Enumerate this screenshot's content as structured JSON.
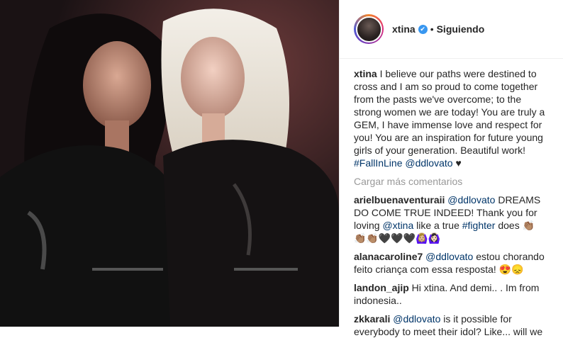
{
  "post": {
    "username": "xtina",
    "verified_badge": "✔",
    "separator": "•",
    "follow_status": "Siguiendo"
  },
  "caption": {
    "username": "xtina",
    "text": "I believe our paths were destined to cross and I am so proud to come together from the pasts we've overcome; to the strong women we are today! You are truly a GEM, I have immense love and respect for you! You are an inspiration for future young girls of your generation. Beautiful work! ",
    "hashtag": "#FallInLine",
    "mention": "@ddlovato",
    "heart": "♥"
  },
  "load_more": "Cargar más comentarios",
  "comments": [
    {
      "username": "arielbuenaventuraii",
      "mention": "@ddlovato",
      "text1": " DREAMS DO COME TRUE INDEED! Thank you for loving ",
      "mention2": "@xtina",
      "text2": " like a true ",
      "hashtag": "#fighter",
      "text3": " does 👏🏽",
      "emoji": "👏🏽👏🏽🖤🖤🖤🙆🏼‍♀️🙆🏻‍♀️"
    },
    {
      "username": "alanacaroline7",
      "mention": "@ddlovato",
      "text": " estou chorando feito criança com essa resposta! 😍😞"
    },
    {
      "username": "landon_ajip",
      "text": " Hi xtina. And demi.. . Im from indonesia.."
    },
    {
      "username": "zkkarali",
      "mention": "@ddlovato",
      "text": " is it possible for everybody to meet their idol? Like... will we"
    }
  ],
  "icons": {
    "avatar": "avatar-icon",
    "verified": "verified-badge-icon"
  },
  "colors": {
    "link": "#003569",
    "muted": "#999999",
    "verified": "#3897f0"
  }
}
